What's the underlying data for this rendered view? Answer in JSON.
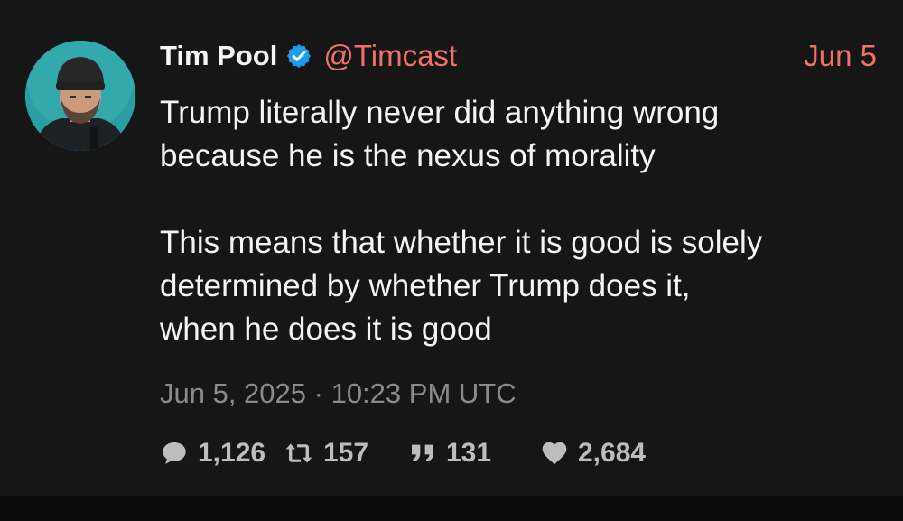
{
  "tweet": {
    "display_name": "Tim Pool",
    "handle": "@Timcast",
    "date_short": "Jun 5",
    "paragraphs": [
      [
        "Trump literally never did anything wrong",
        "because he is the nexus of morality"
      ],
      [
        "This means that whether it is good is solely",
        "determined by whether Trump does it,",
        "when he does it is good"
      ]
    ],
    "timestamp": "Jun 5, 2025 · 10:23 PM UTC",
    "stats": {
      "replies": "1,126",
      "reposts": "157",
      "quotes": "131",
      "likes": "2,684"
    }
  },
  "icons": {
    "verified": "verified-badge-icon",
    "reply": "speech-bubble-icon",
    "repost": "retweet-icon",
    "quote": "quote-icon",
    "like": "heart-icon"
  },
  "colors": {
    "background": "#161616",
    "accent": "#f07169",
    "verified": "#1d9bf0",
    "muted": "#8b8b8b"
  }
}
